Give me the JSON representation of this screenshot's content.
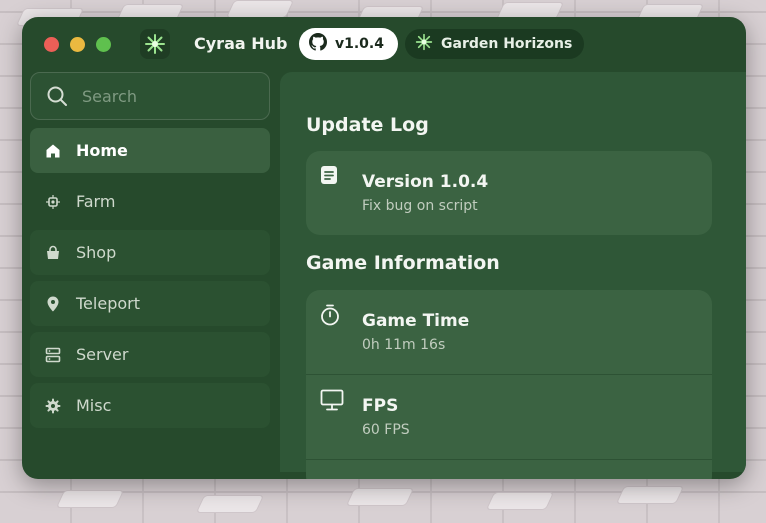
{
  "window": {
    "title": "Cyraa Hub",
    "version_pill": "v1.0.4",
    "game_pill": "Garden Horizons"
  },
  "sidebar": {
    "search_placeholder": "Search",
    "items": [
      {
        "label": "Home",
        "icon": "home-icon",
        "active": true
      },
      {
        "label": "Farm",
        "icon": "farm-icon"
      },
      {
        "label": "Shop",
        "icon": "shop-icon"
      },
      {
        "label": "Teleport",
        "icon": "location-pin-icon"
      },
      {
        "label": "Server",
        "icon": "server-icon"
      },
      {
        "label": "Misc",
        "icon": "gear-icon"
      }
    ]
  },
  "main": {
    "update_log": {
      "title": "Update Log",
      "entries": [
        {
          "title": "Version 1.0.4",
          "subtitle": "Fix bug on script",
          "icon": "document-icon"
        }
      ]
    },
    "game_info": {
      "title": "Game Information",
      "rows": [
        {
          "title": "Game Time",
          "value": "0h 11m 16s",
          "icon": "stopwatch-icon"
        },
        {
          "title": "FPS",
          "value": "60 FPS",
          "icon": "monitor-icon"
        }
      ]
    }
  },
  "colors": {
    "window_bg": "#264a2c",
    "panel_bg": "#2f5737",
    "card_bg": "#3b6342",
    "active_nav": "#3a6040",
    "text_primary": "#f3f6f2"
  }
}
